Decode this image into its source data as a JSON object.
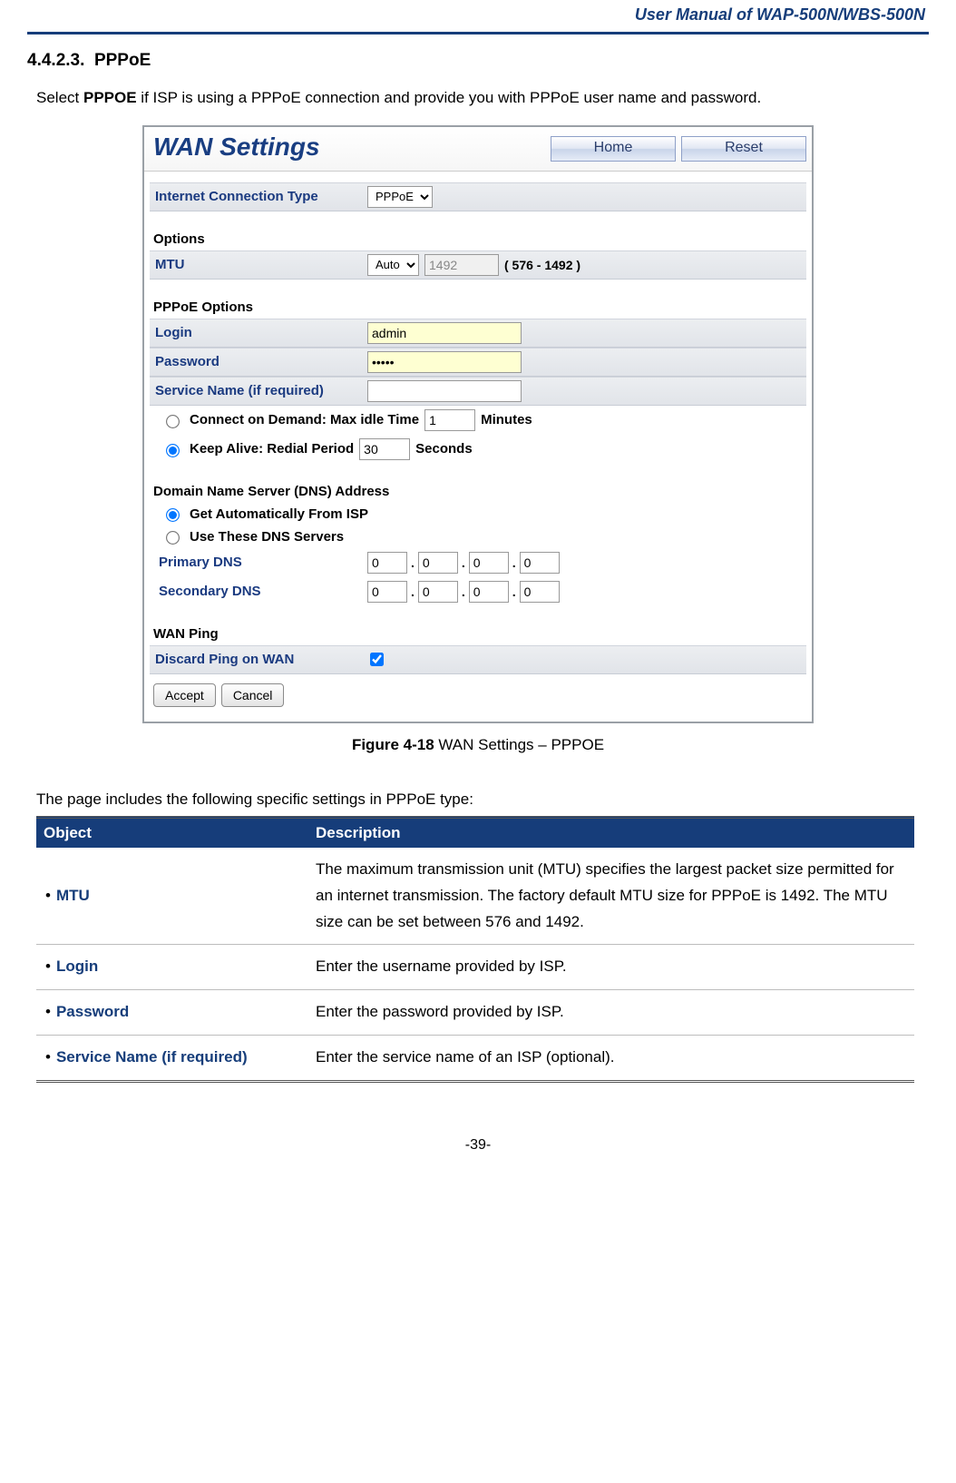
{
  "doc_header": "User  Manual  of  WAP-500N/WBS-500N",
  "section": {
    "number": "4.4.2.3.",
    "title": "PPPoE"
  },
  "intro_pre": "Select ",
  "intro_bold": "PPPOE",
  "intro_post": " if ISP is using a PPPoE connection and provide you with PPPoE user name and password.",
  "wan": {
    "title": "WAN Settings",
    "home": "Home",
    "reset": "Reset",
    "conn_type_label": "Internet Connection Type",
    "conn_type_value": "PPPoE",
    "options_head": "Options",
    "mtu_label": "MTU",
    "mtu_mode": "Auto",
    "mtu_value": "1492",
    "mtu_range": "( 576 - 1492 )",
    "pppoe_head": "PPPoE Options",
    "login_label": "Login",
    "login_value": "admin",
    "password_label": "Password",
    "password_value": "•••••",
    "service_label": "Service Name (if required)",
    "service_value": "",
    "cod_label_pre": "Connect on Demand: Max idle Time",
    "cod_value": "1",
    "cod_label_post": "Minutes",
    "ka_label_pre": "Keep Alive: Redial Period",
    "ka_value": "30",
    "ka_label_post": "Seconds",
    "dns_head": "Domain Name Server (DNS) Address",
    "dns_auto": "Get Automatically From ISP",
    "dns_use": "Use These DNS Servers",
    "pri_dns_label": "Primary DNS",
    "sec_dns_label": "Secondary DNS",
    "ip_zero": "0",
    "wanping_head": "WAN Ping",
    "discard_label": "Discard Ping on WAN",
    "accept": "Accept",
    "cancel": "Cancel"
  },
  "caption_bold": "Figure 4-18",
  "caption_rest": " WAN Settings – PPPOE",
  "lead2": "The page includes the following specific settings in PPPoE type:",
  "table": {
    "h1": "Object",
    "h2": "Description",
    "rows": [
      {
        "obj": "MTU",
        "desc": "The maximum transmission unit (MTU) specifies the largest packet size permitted for an internet transmission. The factory default MTU size for PPPoE is 1492. The MTU size can be set between 576 and 1492."
      },
      {
        "obj": "Login",
        "desc": "Enter the username provided by ISP."
      },
      {
        "obj": "Password",
        "desc": "Enter the password provided by ISP."
      },
      {
        "obj": "Service Name (if required)",
        "desc": "Enter the service name of an ISP (optional)."
      }
    ]
  },
  "page_number": "-39-"
}
